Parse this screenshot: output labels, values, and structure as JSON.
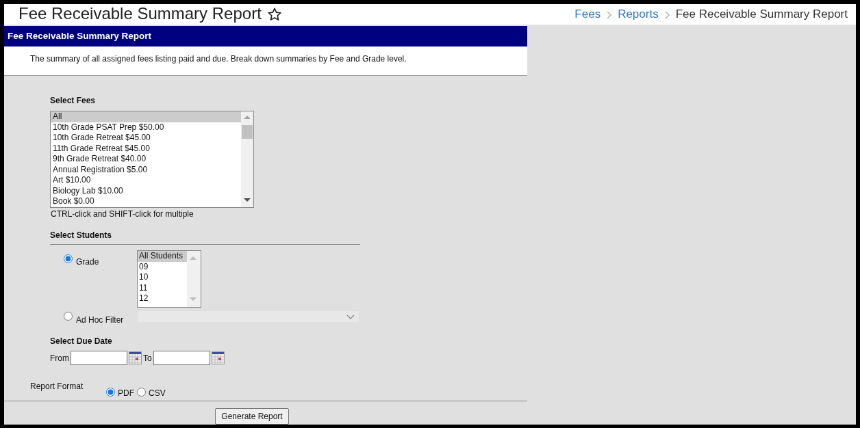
{
  "header": {
    "title": "Fee Receivable Summary Report"
  },
  "breadcrumb": [
    {
      "label": "Fees",
      "link": true
    },
    {
      "label": "Reports",
      "link": true
    },
    {
      "label": "Fee Receivable Summary Report",
      "link": false
    }
  ],
  "panel": {
    "title": "Fee Receivable Summary Report",
    "description": "The summary of all assigned fees listing paid and due. Break down summaries by Fee and Grade level."
  },
  "fees": {
    "label": "Select Fees",
    "items": [
      {
        "label": "All",
        "selected": true
      },
      {
        "label": "10th Grade PSAT Prep $50.00",
        "selected": false
      },
      {
        "label": "10th Grade Retreat $45.00",
        "selected": false
      },
      {
        "label": "11th Grade Retreat $45.00",
        "selected": false
      },
      {
        "label": "9th Grade Retreat $40.00",
        "selected": false
      },
      {
        "label": "Annual Registration $5.00",
        "selected": false
      },
      {
        "label": "Art $10.00",
        "selected": false
      },
      {
        "label": "Biology Lab $10.00",
        "selected": false
      },
      {
        "label": "Book $0.00",
        "selected": false
      }
    ],
    "hint": "CTRL-click and SHIFT-click for multiple"
  },
  "students": {
    "label": "Select Students",
    "options": [
      {
        "label": "Grade",
        "selected": true,
        "kind": "listbox",
        "items": [
          {
            "label": "All Students",
            "selected": true
          },
          {
            "label": "09",
            "selected": false
          },
          {
            "label": "10",
            "selected": false
          },
          {
            "label": "11",
            "selected": false
          },
          {
            "label": "12",
            "selected": false
          }
        ]
      },
      {
        "label": "Ad Hoc Filter",
        "selected": false,
        "kind": "dropdown",
        "disabled": true
      }
    ]
  },
  "due_date": {
    "label": "Select Due Date",
    "from_label": "From",
    "to_label": "To"
  },
  "report_format": {
    "label": "Report Format",
    "options": [
      {
        "label": "PDF",
        "selected": true
      },
      {
        "label": "CSV",
        "selected": false
      }
    ]
  },
  "button": "Generate Report"
}
